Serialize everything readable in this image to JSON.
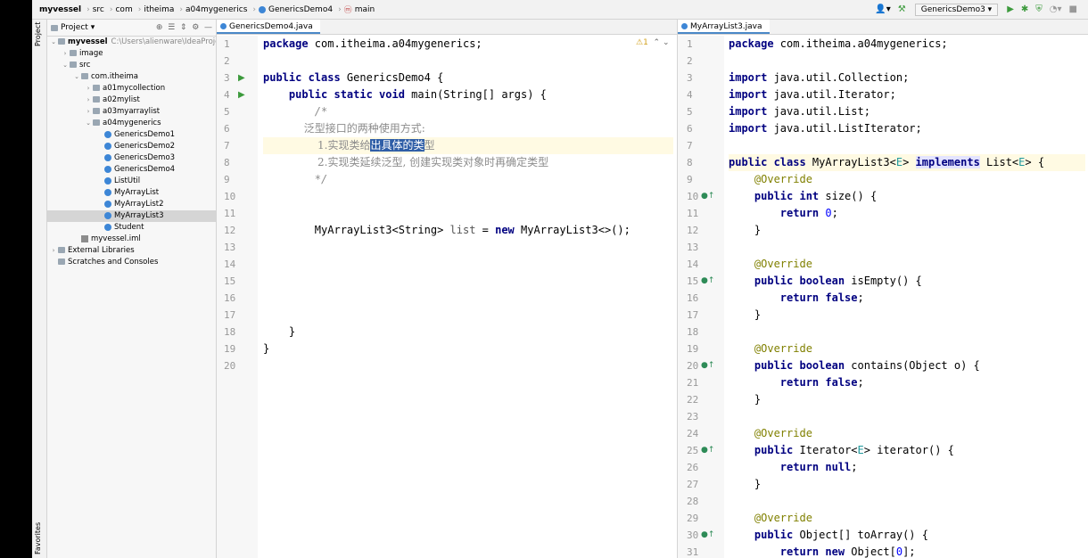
{
  "breadcrumb": {
    "items": [
      "myvessel",
      "src",
      "com",
      "itheima",
      "a04mygenerics",
      "GenericsDemo4",
      "main"
    ]
  },
  "toolbar": {
    "run_config": "GenericsDemo3"
  },
  "side_strip": {
    "project_label": "Project",
    "favorites_label": "Favorites"
  },
  "project": {
    "header": "Project",
    "tree": [
      {
        "label": "myvessel",
        "path": "C:\\Users\\alienware\\IdeaProjects\\",
        "indent": 0,
        "type": "module",
        "arrow": "open"
      },
      {
        "label": "image",
        "indent": 1,
        "type": "folder",
        "arrow": "closed"
      },
      {
        "label": "src",
        "indent": 1,
        "type": "folder",
        "arrow": "open"
      },
      {
        "label": "com.itheima",
        "indent": 2,
        "type": "folder",
        "arrow": "open"
      },
      {
        "label": "a01mycollection",
        "indent": 3,
        "type": "folder",
        "arrow": "closed"
      },
      {
        "label": "a02mylist",
        "indent": 3,
        "type": "folder",
        "arrow": "closed"
      },
      {
        "label": "a03myarraylist",
        "indent": 3,
        "type": "folder",
        "arrow": "closed"
      },
      {
        "label": "a04mygenerics",
        "indent": 3,
        "type": "folder",
        "arrow": "open"
      },
      {
        "label": "GenericsDemo1",
        "indent": 4,
        "type": "class"
      },
      {
        "label": "GenericsDemo2",
        "indent": 4,
        "type": "class"
      },
      {
        "label": "GenericsDemo3",
        "indent": 4,
        "type": "class"
      },
      {
        "label": "GenericsDemo4",
        "indent": 4,
        "type": "class"
      },
      {
        "label": "ListUtil",
        "indent": 4,
        "type": "class"
      },
      {
        "label": "MyArrayList",
        "indent": 4,
        "type": "class"
      },
      {
        "label": "MyArrayList2",
        "indent": 4,
        "type": "class"
      },
      {
        "label": "MyArrayList3",
        "indent": 4,
        "type": "class",
        "selected": true
      },
      {
        "label": "Student",
        "indent": 4,
        "type": "class"
      },
      {
        "label": "myvessel.iml",
        "indent": 2,
        "type": "file"
      },
      {
        "label": "External Libraries",
        "indent": 0,
        "type": "lib",
        "arrow": "closed"
      },
      {
        "label": "Scratches and Consoles",
        "indent": 0,
        "type": "lib"
      }
    ]
  },
  "left_editor": {
    "tab": "GenericsDemo4.java",
    "warning_count": "1",
    "line_numbers": [
      "1",
      "2",
      "3",
      "4",
      "5",
      "6",
      "7",
      "8",
      "9",
      "10",
      "11",
      "12",
      "13",
      "14",
      "15",
      "16",
      "17",
      "18",
      "19",
      "20"
    ]
  },
  "right_editor": {
    "tab": "MyArrayList3.java",
    "line_numbers": [
      "1",
      "2",
      "3",
      "4",
      "5",
      "6",
      "7",
      "8",
      "9",
      "10",
      "11",
      "12",
      "13",
      "14",
      "15",
      "16",
      "17",
      "18",
      "19",
      "20",
      "21",
      "22",
      "23",
      "24",
      "25",
      "26",
      "27",
      "28",
      "29",
      "30",
      "31"
    ]
  }
}
